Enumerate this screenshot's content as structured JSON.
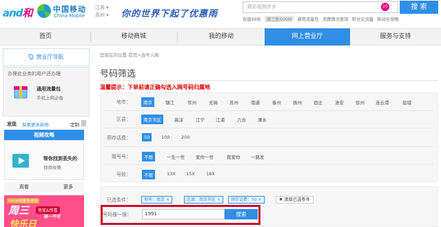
{
  "header": {
    "logo_and": "and",
    "logo_he": "和",
    "brand_cn": "中国移动",
    "brand_en": "China Mobile",
    "province": "江苏",
    "city": "苏州",
    "slogan": "你的世界下起了优惠雨",
    "search_placeholder": "精彩视频步步",
    "badge_count": "10",
    "search_button": "搜 索",
    "quick_links": [
      "充值99折",
      "周三秒500M",
      "通用流量包",
      "消费情况查询",
      "积分兑流量",
      "移动全攻略"
    ]
  },
  "nav": {
    "items": [
      "首页",
      "移动商城",
      "我的移动",
      "网上营业厅",
      "服务与支持"
    ],
    "active_index": 3
  },
  "sidebar": {
    "title": "营业厅导航",
    "panel_heading": "办理此业务的用户还办理",
    "package_name": "通用流量包",
    "package_desc": "手机上网必备",
    "discover": "发现",
    "discover_sub": "探索更多新奇",
    "customize": "定制",
    "video_title": "视频攻略",
    "video_line1": "帮你找到丢失的",
    "video_line2": "视频攻略",
    "tab_watch": "观看",
    "tab_more": "更多",
    "banner_tag": "500M流量免费领",
    "banner_big": "周三",
    "banner_pill": "答奖&惊喜",
    "banner_pill2": "缺一不可",
    "banner_bottom": "快乐日"
  },
  "main": {
    "breadcrumb": "您现在的位置:首页>选号入网",
    "title": "号码筛选",
    "tip": "温馨提示：下单前请正确勾选入网号码归属地",
    "filters": {
      "location": {
        "label": "地市：",
        "options": [
          "南京",
          "镇江",
          "常州",
          "无锡",
          "苏州",
          "南通",
          "泰州",
          "扬州",
          "宿迁",
          "淮安",
          "徐州",
          "连云港",
          "盐城"
        ],
        "selected": 0
      },
      "district": {
        "label": "区县：",
        "options": [
          "南京市区",
          "高淳",
          "江宁",
          "江浦",
          "六合",
          "溧水"
        ],
        "selected": 0
      },
      "prestore": {
        "label": "预存话费：",
        "options": [
          "50",
          "100",
          "200"
        ],
        "selected": 0
      },
      "pattern": {
        "label": "靓号号：",
        "options": [
          "不限",
          "一生一世",
          "爱你一世",
          "我爱你",
          "一路发"
        ],
        "selected": 0
      },
      "segment": {
        "label": "号段：",
        "options": [
          "不限",
          "13X",
          "15X",
          "18X"
        ],
        "selected": 0
      }
    },
    "selected_conditions": {
      "label": "已选条件：",
      "chips": [
        "地市：南京 ×",
        "区县：南京市区 ×",
        "预存话费：50 ×"
      ],
      "clear_button": "清除已选条件"
    },
    "number_search": {
      "label": "号码搜一搜：",
      "value": "1991",
      "button": "搜索"
    }
  }
}
